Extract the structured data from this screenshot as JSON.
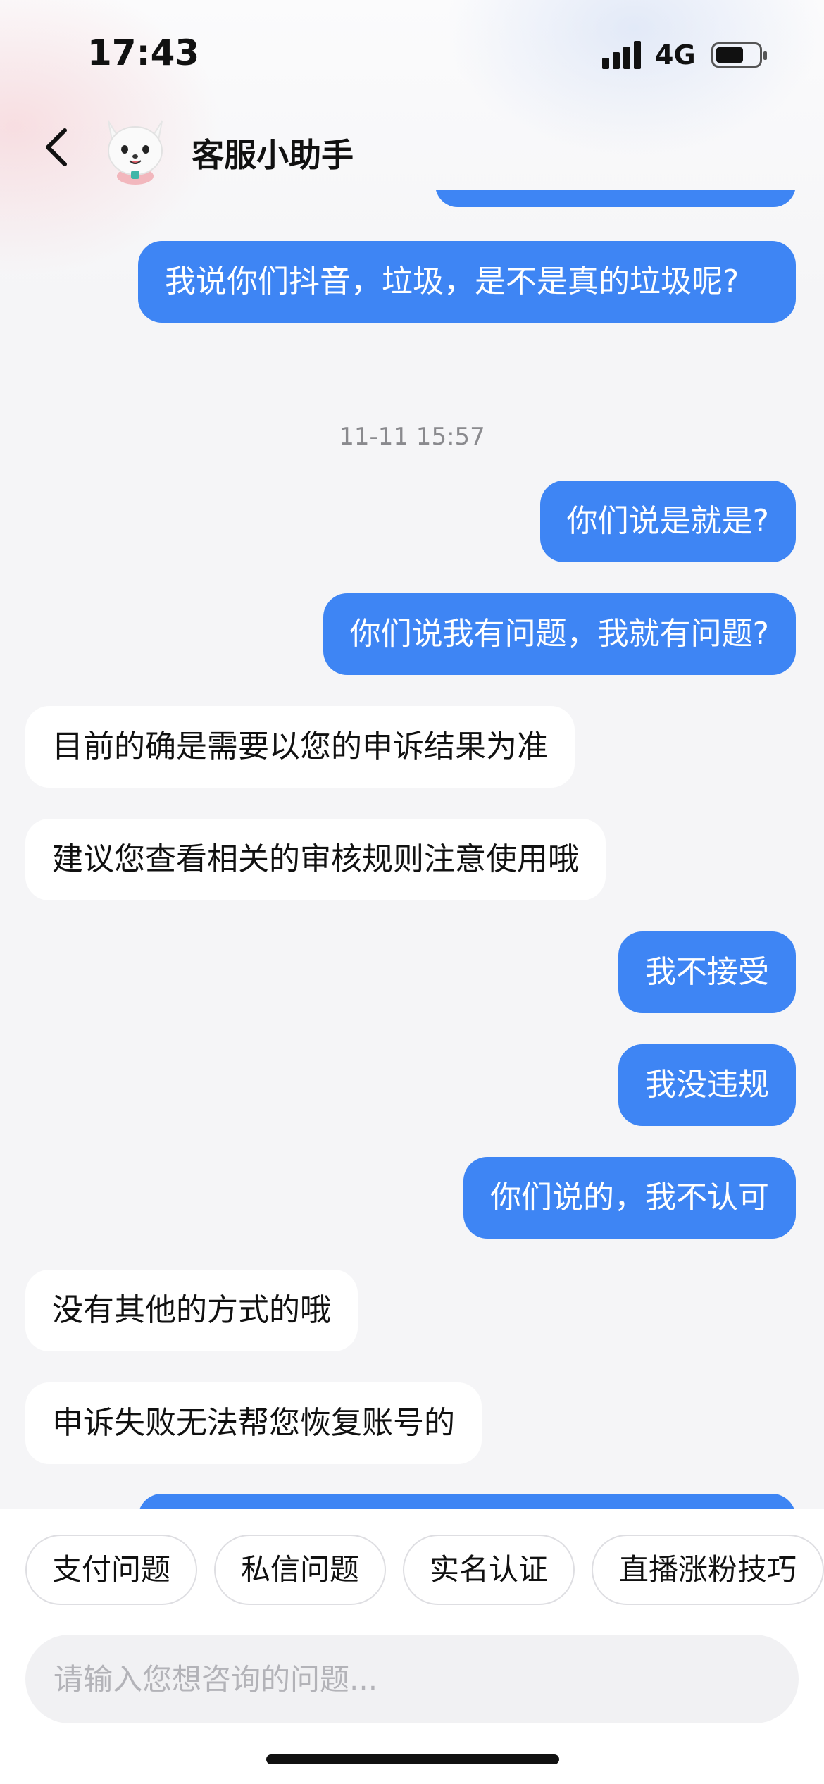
{
  "status_bar": {
    "time": "17:43",
    "network": "4G",
    "signal_bars": 4,
    "battery_level": 0.6
  },
  "header": {
    "back_icon": "chevron-left-icon",
    "avatar_icon": "white-cat-mascot-avatar",
    "title": "客服小助手"
  },
  "messages": [
    {
      "side": "out",
      "text": "我说你们抖音，垃圾，是不是真的垃圾呢?",
      "partial": false
    },
    {
      "type": "timestamp",
      "text": "11-11 15:57"
    },
    {
      "side": "out",
      "text": "你们说是就是?"
    },
    {
      "side": "out",
      "text": "你们说我有问题，我就有问题?"
    },
    {
      "side": "in",
      "text": "目前的确是需要以您的申诉结果为准"
    },
    {
      "side": "in",
      "text": "建议您查看相关的审核规则注意使用哦"
    },
    {
      "side": "out",
      "text": "我不接受"
    },
    {
      "side": "out",
      "text": "我没违规"
    },
    {
      "side": "out",
      "text": "你们说的，我不认可"
    },
    {
      "side": "in",
      "text": "没有其他的方式的哦"
    },
    {
      "side": "in",
      "text": "申诉失败无法帮您恢复账号的"
    }
  ],
  "quick_replies": [
    "支付问题",
    "私信问题",
    "实名认证",
    "直播涨粉技巧"
  ],
  "input": {
    "placeholder": "请输入您想咨询的问题..."
  },
  "colors": {
    "outgoing_bubble": "#3e85f4",
    "incoming_bubble": "#ffffff",
    "background": "#f5f5f7"
  }
}
